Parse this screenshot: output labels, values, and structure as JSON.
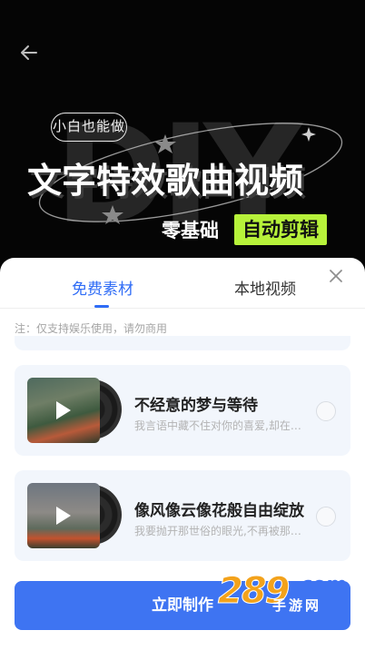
{
  "hero": {
    "tag": "小白也能做",
    "headline": "文字特效歌曲视频",
    "sub_left": "零基础",
    "sub_right": "自动剪辑",
    "ghost_text": "DIY"
  },
  "tabs": [
    {
      "label": "免费素材",
      "active": true
    },
    {
      "label": "本地视频",
      "active": false
    }
  ],
  "note": "注：仅支持娱乐使用，请勿商用",
  "items": [
    {
      "title": "不经意的梦与等待",
      "desc": "我言语中藏不住对你的喜爱,却在…",
      "selected": false
    },
    {
      "title": "像风像云像花般自由绽放",
      "desc": "我要抛开那世俗的眼光,不再被那…",
      "selected": false
    }
  ],
  "cta": "立即制作",
  "watermark": {
    "num": "289",
    "domain": ".com",
    "cn": "手游网"
  },
  "colors": {
    "accent": "#2f6cf6",
    "cta": "#3e74f2",
    "highlight": "#b7f23a"
  }
}
